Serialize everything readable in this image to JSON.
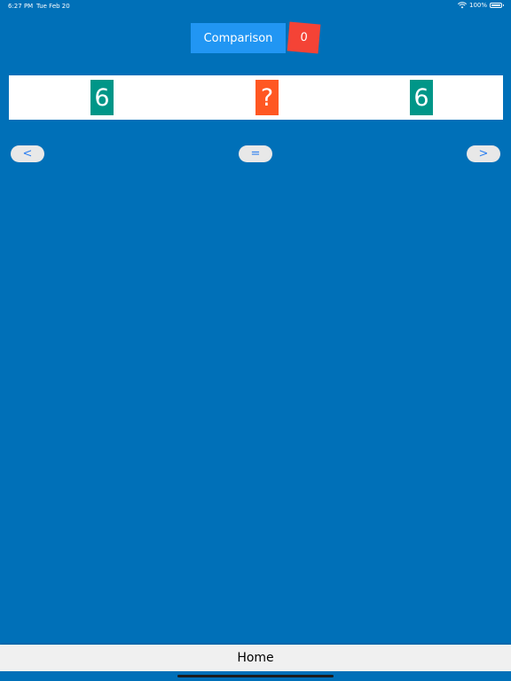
{
  "status_bar": {
    "time": "6:27 PM",
    "date": "Tue Feb 20",
    "battery": "100%",
    "wifi_icon": "wifi-icon",
    "battery_icon": "battery-icon"
  },
  "header": {
    "title": "Comparison",
    "score": "0"
  },
  "comparison": {
    "left_value": "6",
    "middle_value": "?",
    "right_value": "6"
  },
  "operators": {
    "less": "<",
    "equal": "=",
    "greater": ">"
  },
  "footer": {
    "home_label": "Home"
  },
  "colors": {
    "background": "#0070b8",
    "title_button": "#2196f3",
    "score_badge": "#f44336",
    "number_card": "#009688",
    "question_card": "#ff5722",
    "operator_text": "#2d7ff0"
  }
}
